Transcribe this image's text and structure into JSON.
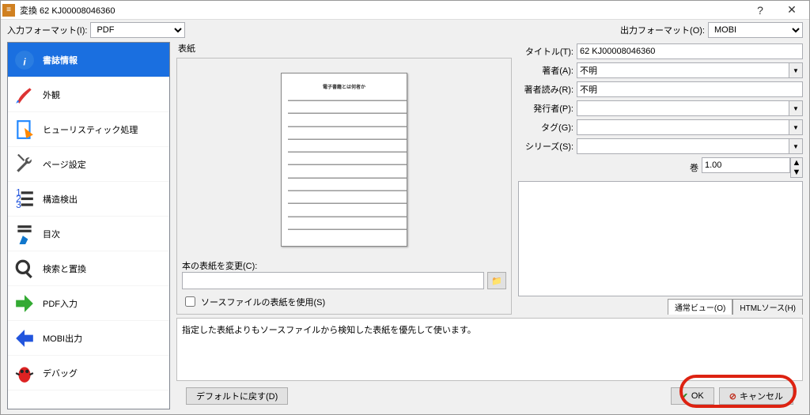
{
  "window": {
    "title": "変換 62 KJ00008046360"
  },
  "topbar": {
    "input_format_label": "入力フォーマット(I):",
    "input_format_value": "PDF",
    "output_format_label": "出力フォーマット(O):",
    "output_format_value": "MOBI"
  },
  "sidebar": {
    "items": [
      {
        "label": "書誌情報",
        "icon": "info-icon",
        "selected": true
      },
      {
        "label": "外観",
        "icon": "brush-icon"
      },
      {
        "label": "ヒューリスティック処理",
        "icon": "page-tag-icon"
      },
      {
        "label": "ページ設定",
        "icon": "wrench-icon"
      },
      {
        "label": "構造検出",
        "icon": "list-123-icon"
      },
      {
        "label": "目次",
        "icon": "hand-point-icon"
      },
      {
        "label": "検索と置換",
        "icon": "magnifier-icon"
      },
      {
        "label": "PDF入力",
        "icon": "arrow-right-green-icon"
      },
      {
        "label": "MOBI出力",
        "icon": "arrow-left-blue-icon"
      },
      {
        "label": "デバッグ",
        "icon": "bug-icon"
      }
    ]
  },
  "cover": {
    "group_title": "表紙",
    "change_label": "本の表紙を変更(C):",
    "change_value": "",
    "use_source_label": "ソースファイルの表紙を使用(S)",
    "page_heading": "電子書籍とは何者か"
  },
  "meta": {
    "title_label": "タイトル(T):",
    "title_value": "62 KJ00008046360",
    "author_label": "著者(A):",
    "author_value": "不明",
    "author_sort_label": "著者読み(R):",
    "author_sort_value": "不明",
    "publisher_label": "発行者(P):",
    "publisher_value": "",
    "tags_label": "タグ(G):",
    "tags_value": "",
    "series_label": "シリーズ(S):",
    "series_value": "",
    "series_index_label": "巻",
    "series_index_value": "1.00",
    "tabs": {
      "normal": "通常ビュー(O)",
      "html": "HTMLソース(H)"
    }
  },
  "hint": "指定した表紙よりもソースファイルから検知した表紙を優先して使います。",
  "buttons": {
    "restore": "デフォルトに戻す(D)",
    "ok": "OK",
    "cancel": "キャンセル"
  }
}
